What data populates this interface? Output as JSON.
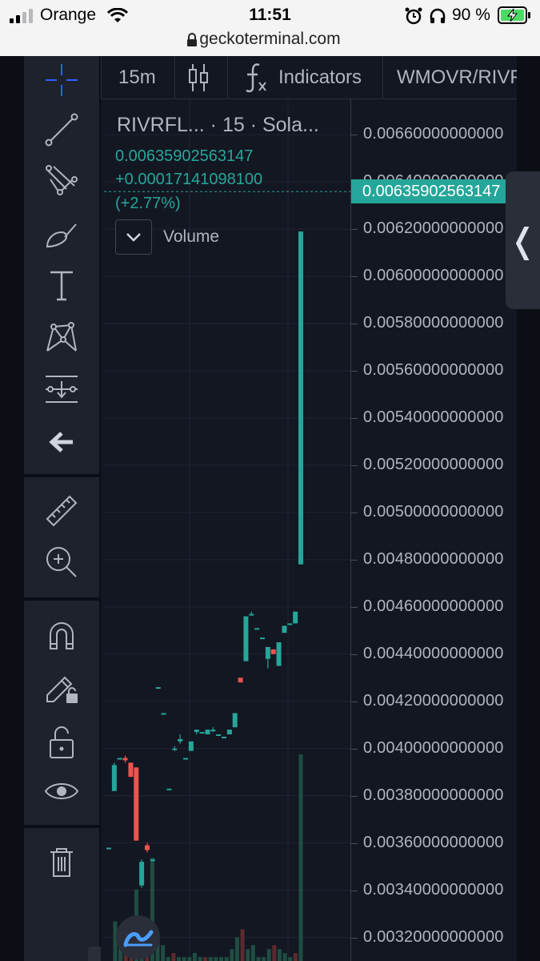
{
  "status_bar": {
    "carrier": "Orange",
    "time": "11:51",
    "battery": "90 %",
    "url": "geckoterminal.com"
  },
  "toolbar": {
    "tools": [
      "crosshair-icon",
      "trend-line-icon",
      "fib-icon",
      "brush-icon",
      "text-icon",
      "pattern-icon",
      "measure-lines-icon",
      "back-arrow-icon",
      "ruler-icon",
      "zoom-in-icon",
      "magnet-icon",
      "lock-pencil-icon",
      "unlock-icon",
      "eye-icon",
      "trash-icon"
    ],
    "collapse_glyph": "‹"
  },
  "topbar": {
    "interval": "15m",
    "indicators_label": "Indicators",
    "pair": "WMOVR/RIVF"
  },
  "legend": {
    "title": "RIVRFL... · 15 · Sola...",
    "price": "0.00635902563147",
    "change": "+0.00017141098100",
    "change_pct": "(+2.77%)",
    "volume_label": "Volume"
  },
  "side_handle_glyph": "❬",
  "colors": {
    "up": "#26a69a",
    "down": "#ef5350",
    "background": "#131722",
    "grid": "#1f2431",
    "text": "#b2b5be"
  },
  "chart_data": {
    "type": "candlestick",
    "price_axis": {
      "ticks": [
        "0.00660000000000",
        "0.00640000000000",
        "0.00620000000000",
        "0.00600000000000",
        "0.00580000000000",
        "0.00560000000000",
        "0.00540000000000",
        "0.00520000000000",
        "0.00500000000000",
        "0.00480000000000",
        "0.00460000000000",
        "0.00440000000000",
        "0.00420000000000",
        "0.00400000000000",
        "0.00380000000000",
        "0.00360000000000",
        "0.00340000000000",
        "0.00320000000000"
      ],
      "range": [
        0.0031,
        0.00675
      ],
      "last_price": "0.00635902563147",
      "last_value": 0.00635902563147
    },
    "candles": [
      {
        "o": 0.00358,
        "c": 0.00358,
        "h": 0.00358,
        "l": 0.00358
      },
      {
        "o": 0.00382,
        "c": 0.00393,
        "h": 0.00394,
        "l": 0.00382
      },
      {
        "o": 0.00396,
        "c": 0.00396,
        "h": 0.00396,
        "l": 0.00396
      },
      {
        "o": 0.00396,
        "c": 0.00395,
        "h": 0.00397,
        "l": 0.00394
      },
      {
        "o": 0.00394,
        "c": 0.00388,
        "h": 0.00394,
        "l": 0.00388
      },
      {
        "o": 0.00392,
        "c": 0.00361,
        "h": 0.00392,
        "l": 0.00361
      },
      {
        "o": 0.00342,
        "c": 0.00352,
        "h": 0.00353,
        "l": 0.00341
      },
      {
        "o": 0.00359,
        "c": 0.00357,
        "h": 0.0036,
        "l": 0.00356
      },
      {
        "o": 0.00353,
        "c": 0.00353,
        "h": 0.00353,
        "l": 0.00353
      },
      {
        "o": 0.00426,
        "c": 0.00426,
        "h": 0.00426,
        "l": 0.00426
      },
      {
        "o": 0.00415,
        "c": 0.00415,
        "h": 0.00415,
        "l": 0.00415
      },
      {
        "o": 0.00383,
        "c": 0.00383,
        "h": 0.00383,
        "l": 0.00383
      },
      {
        "o": 0.004,
        "c": 0.004,
        "h": 0.00401,
        "l": 0.00399
      },
      {
        "o": 0.00403,
        "c": 0.00404,
        "h": 0.00406,
        "l": 0.00402
      },
      {
        "o": 0.00396,
        "c": 0.00396,
        "h": 0.00396,
        "l": 0.00396
      },
      {
        "o": 0.00399,
        "c": 0.00403,
        "h": 0.00403,
        "l": 0.00399
      },
      {
        "o": 0.00407,
        "c": 0.00408,
        "h": 0.00408,
        "l": 0.00406
      },
      {
        "o": 0.00407,
        "c": 0.00407,
        "h": 0.00407,
        "l": 0.00407
      },
      {
        "o": 0.00406,
        "c": 0.00408,
        "h": 0.00408,
        "l": 0.00406
      },
      {
        "o": 0.00408,
        "c": 0.00408,
        "h": 0.00409,
        "l": 0.00407
      },
      {
        "o": 0.00406,
        "c": 0.00406,
        "h": 0.00406,
        "l": 0.00406
      },
      {
        "o": 0.00405,
        "c": 0.00405,
        "h": 0.00405,
        "l": 0.00405
      },
      {
        "o": 0.00406,
        "c": 0.00408,
        "h": 0.00408,
        "l": 0.00406
      },
      {
        "o": 0.00409,
        "c": 0.00415,
        "h": 0.00415,
        "l": 0.00409
      },
      {
        "o": 0.0043,
        "c": 0.00428,
        "h": 0.0043,
        "l": 0.00428
      },
      {
        "o": 0.00437,
        "c": 0.00456,
        "h": 0.00456,
        "l": 0.00437
      },
      {
        "o": 0.00457,
        "c": 0.00457,
        "h": 0.00458,
        "l": 0.00457
      },
      {
        "o": 0.00451,
        "c": 0.00451,
        "h": 0.00451,
        "l": 0.00451
      },
      {
        "o": 0.00447,
        "c": 0.00447,
        "h": 0.00447,
        "l": 0.00447
      },
      {
        "o": 0.00438,
        "c": 0.00443,
        "h": 0.00443,
        "l": 0.00434
      },
      {
        "o": 0.00442,
        "c": 0.0044,
        "h": 0.00442,
        "l": 0.0044
      },
      {
        "o": 0.00435,
        "c": 0.00445,
        "h": 0.00445,
        "l": 0.00435
      },
      {
        "o": 0.00449,
        "c": 0.00452,
        "h": 0.00452,
        "l": 0.00449
      },
      {
        "o": 0.00453,
        "c": 0.00453,
        "h": 0.00453,
        "l": 0.00453
      },
      {
        "o": 0.00453,
        "c": 0.00458,
        "h": 0.00458,
        "l": 0.00453
      },
      {
        "o": 0.00478,
        "c": 0.00619,
        "h": 0.00619,
        "l": 0.00478
      }
    ],
    "volume_bars": [
      {
        "v": 0.5,
        "up": true
      },
      {
        "v": 0.2,
        "up": true
      },
      {
        "v": 0.1,
        "up": false
      },
      {
        "v": 0.15,
        "up": false
      },
      {
        "v": 0.9,
        "up": true
      },
      {
        "v": 0.35,
        "up": true
      },
      {
        "v": 0.2,
        "up": false
      },
      {
        "v": 1.3,
        "up": true
      },
      {
        "v": 0.25,
        "up": true
      },
      {
        "v": 0.2,
        "up": true
      },
      {
        "v": 0.05,
        "up": true
      },
      {
        "v": 0.1,
        "up": false
      },
      {
        "v": 0.05,
        "up": true
      },
      {
        "v": 0.05,
        "up": true
      },
      {
        "v": 0.05,
        "up": true
      },
      {
        "v": 0.1,
        "up": true
      },
      {
        "v": 0.05,
        "up": true
      },
      {
        "v": 0.05,
        "up": false
      },
      {
        "v": 0.05,
        "up": true
      },
      {
        "v": 0.05,
        "up": true
      },
      {
        "v": 0.05,
        "up": true
      },
      {
        "v": 0.05,
        "up": true
      },
      {
        "v": 0.15,
        "up": true
      },
      {
        "v": 0.3,
        "up": true
      },
      {
        "v": 0.4,
        "up": false
      },
      {
        "v": 0.15,
        "up": true
      },
      {
        "v": 0.2,
        "up": true
      },
      {
        "v": 0.05,
        "up": true
      },
      {
        "v": 0.05,
        "up": true
      },
      {
        "v": 0.15,
        "up": true
      },
      {
        "v": 0.2,
        "up": false
      },
      {
        "v": 0.15,
        "up": true
      },
      {
        "v": 0.1,
        "up": true
      },
      {
        "v": 0.05,
        "up": true
      },
      {
        "v": 0.1,
        "up": false
      },
      {
        "v": 2.6,
        "up": true
      }
    ]
  }
}
